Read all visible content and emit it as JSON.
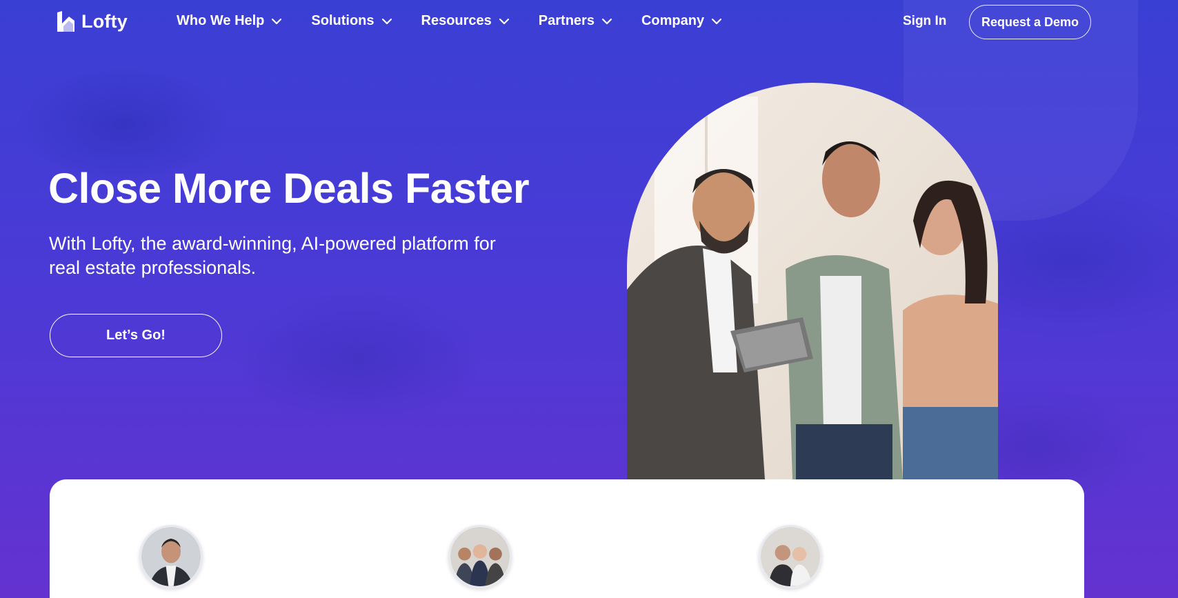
{
  "brand": {
    "name": "Lofty"
  },
  "nav": {
    "items": [
      {
        "label": "Who We Help"
      },
      {
        "label": "Solutions"
      },
      {
        "label": "Resources"
      },
      {
        "label": "Partners"
      },
      {
        "label": "Company"
      }
    ],
    "sign_in": "Sign In",
    "request_demo": "Request a Demo"
  },
  "hero": {
    "title": "Close More Deals Faster",
    "subtitle": "With Lofty, the award-winning, AI-powered platform for real estate professionals.",
    "cta": "Let’s Go!"
  },
  "icons": {
    "logo": "lofty-logo-icon",
    "dropdown": "chevron-down-icon"
  },
  "colors": {
    "background_top": "#3a3fd4",
    "background_bottom": "#6432cf",
    "text": "#ffffff",
    "card": "#ffffff"
  }
}
